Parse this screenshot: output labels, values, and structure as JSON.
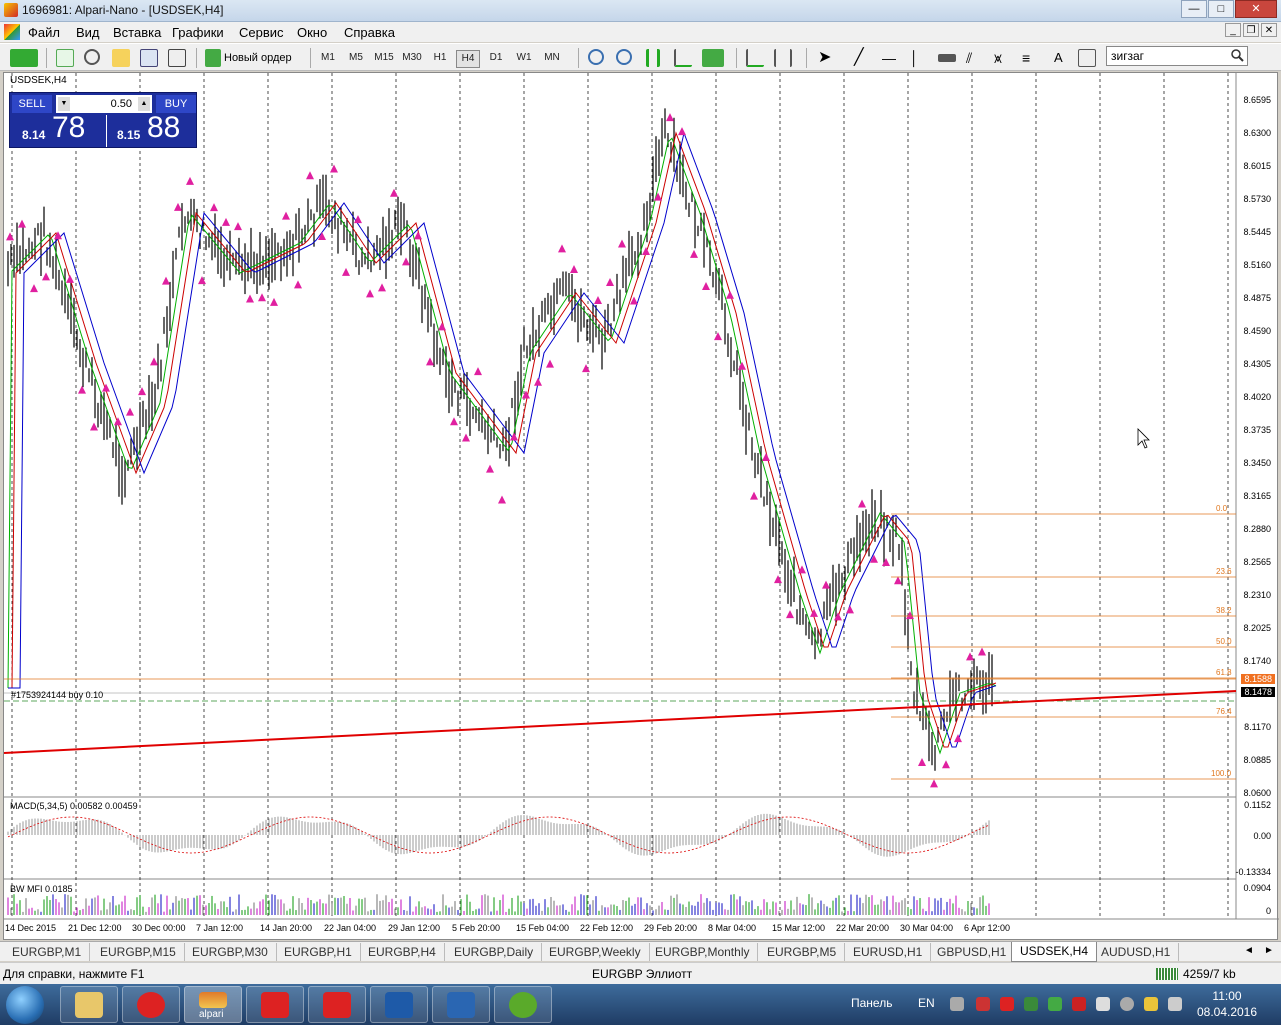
{
  "window": {
    "title": "1696981: Alpari-Nano - [USDSEK,H4]",
    "min": "—",
    "max": "□",
    "close": "✕"
  },
  "menu": [
    "Файл",
    "Вид",
    "Вставка",
    "Графики",
    "Сервис",
    "Окно",
    "Справка"
  ],
  "toolbar": {
    "new_order": "Новый ордер",
    "timeframes": [
      "M1",
      "M5",
      "M15",
      "M30",
      "H1",
      "H4",
      "D1",
      "W1",
      "MN"
    ],
    "selected_tf": "H4",
    "text_tool": "A",
    "search_value": "зигзаг"
  },
  "chart": {
    "symbol": "USDSEK,H4",
    "trade_panel": {
      "sell_label": "SELL",
      "buy_label": "BUY",
      "lot": "0.50",
      "sell_small": "8.14",
      "sell_big": "78",
      "buy_small": "8.15",
      "buy_big": "88"
    },
    "order_line_label": "#1753924144 buy 0.10",
    "price_axis": [
      "8.6595",
      "8.6300",
      "8.6015",
      "8.5730",
      "8.5445",
      "8.5160",
      "8.4875",
      "8.4590",
      "8.4305",
      "8.4020",
      "8.3735",
      "8.3450",
      "8.3165",
      "8.2880",
      "8.2565",
      "8.2310",
      "8.2025",
      "8.1740",
      "8.1170",
      "8.0885",
      "8.0600"
    ],
    "ask_tag": "8.1588",
    "bid_tag": "8.1478",
    "fibo_levels": [
      "0.0",
      "23.6",
      "38.2",
      "50.0",
      "61.8",
      "76.4",
      "100.0"
    ],
    "time_axis": [
      "14 Dec 2015",
      "21 Dec 12:00",
      "30 Dec 00:00",
      "7 Jan 12:00",
      "14 Jan 20:00",
      "22 Jan 04:00",
      "29 Jan 12:00",
      "5 Feb 20:00",
      "15 Feb 04:00",
      "22 Feb 12:00",
      "29 Feb 20:00",
      "8 Mar 04:00",
      "15 Mar 12:00",
      "22 Mar 20:00",
      "30 Mar 04:00",
      "6 Apr 12:00"
    ],
    "macd": {
      "label": "MACD(5,34,5) 0.00582 0.00459",
      "axis": [
        "0.1152",
        "0.00",
        "-0.13334"
      ]
    },
    "mfi": {
      "label": "BW MFI 0.0185",
      "axis": [
        "0.0904",
        "0"
      ]
    },
    "colors": {
      "red_ma": "#cc0000",
      "green_ma": "#00b000",
      "blue_ma": "#0000cc",
      "trend": "#e00000",
      "fibo": "#e07820",
      "zigzag": "#e020a0"
    }
  },
  "tabs": [
    "EURGBP,M1",
    "EURGBP,M15",
    "EURGBP,M30",
    "EURGBP,H1",
    "EURGBP,H4",
    "EURGBP,Daily",
    "EURGBP,Weekly",
    "EURGBP,Monthly",
    "EURGBP,M5",
    "EURUSD,H1",
    "GBPUSD,H1",
    "USDSEK,H4",
    "AUDUSD,H1"
  ],
  "active_tab": "USDSEK,H4",
  "status": {
    "help": "Для справки, нажмите F1",
    "profile": "EURGBP Эллиотт",
    "conn": "4259/7 kb"
  },
  "taskbar": {
    "panel": "Панель",
    "lang": "EN",
    "time": "11:00",
    "date": "08.04.2016",
    "alpari": "alpari"
  }
}
